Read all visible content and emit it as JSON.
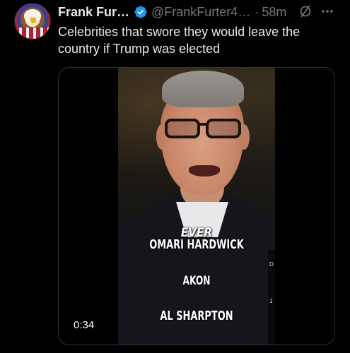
{
  "tweet": {
    "author": {
      "display_name": "Frank Fur…",
      "handle": "@FrankFurter4…",
      "verified": true
    },
    "separator": "·",
    "timestamp": "58m",
    "text": "Celebrities that swore they would leave the country if Trump was elected",
    "media": {
      "type": "video",
      "duration": "0:34",
      "captions": {
        "ever": "EVER",
        "name1": "OMARI HARDWICK",
        "name2": "AKON",
        "name3": "AL SHARPTON"
      },
      "edge_letters": [
        "D",
        "1"
      ]
    },
    "icons": {
      "verified": "verified-badge-icon",
      "grok": "grok-icon",
      "more": "more-options-icon"
    }
  },
  "colors": {
    "background": "#000000",
    "primary_text": "#e7e9ea",
    "secondary_text": "#71767b",
    "verified_blue": "#1d9bf0",
    "border": "#2f3336"
  }
}
